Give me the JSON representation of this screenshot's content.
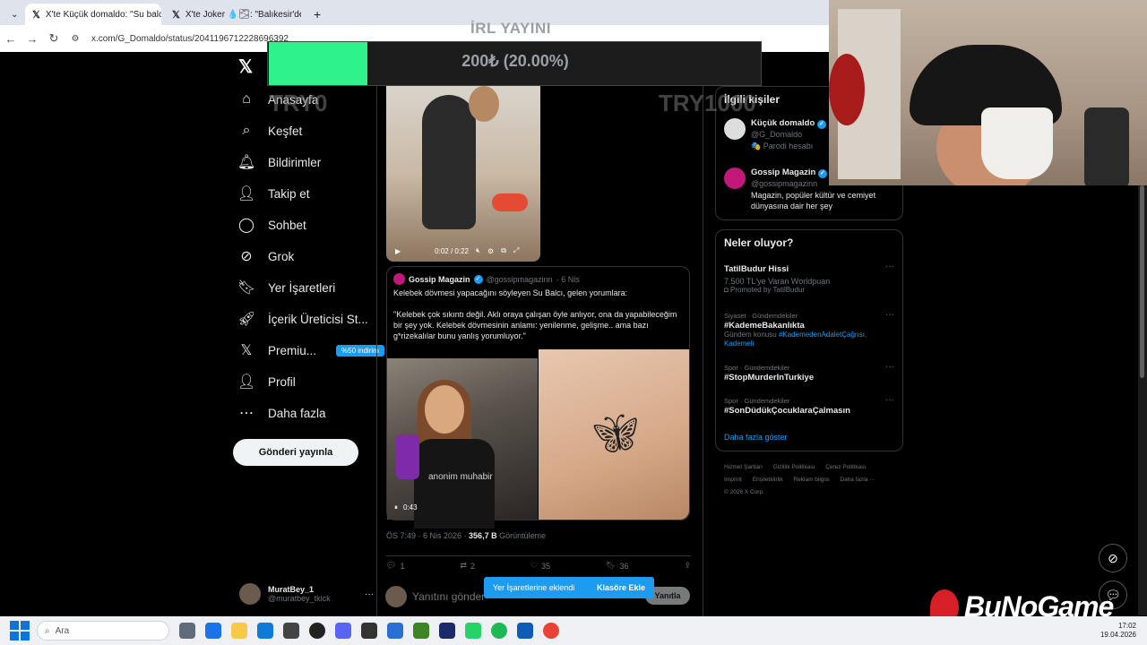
{
  "browser": {
    "tabs": [
      {
        "label": "X'te Küçük domaldo: \"Su balcı",
        "active": true
      },
      {
        "label": "X'te Joker 💧🌫: \"Balıkesir'de",
        "active": false
      }
    ],
    "new_tab": "+",
    "url": "x.com/G_Domaldo/status/2041196712228696392"
  },
  "overlay": {
    "title": "İRL YAYINI",
    "donation_text": "200₺ (20.00%)",
    "progress": 0.2,
    "min_label": "TRY0",
    "max_label": "TRY1000",
    "fill_color": "#2ef28b"
  },
  "nav": {
    "items": [
      {
        "label": "Anasayfa",
        "icon": "home-icon"
      },
      {
        "label": "Keşfet",
        "icon": "search-icon"
      },
      {
        "label": "Bildirimler",
        "icon": "bell-icon"
      },
      {
        "label": "Takip et",
        "icon": "add-person-icon"
      },
      {
        "label": "Sohbet",
        "icon": "chat-icon"
      },
      {
        "label": "Grok",
        "icon": "grok-icon"
      },
      {
        "label": "Yer İşaretleri",
        "icon": "bookmark-icon"
      },
      {
        "label": "İçerik Üreticisi St...",
        "icon": "rocket-icon"
      },
      {
        "label": "Premiu...",
        "icon": "x-icon",
        "badge": "%50 indirim"
      },
      {
        "label": "Profil",
        "icon": "person-icon"
      },
      {
        "label": "Daha fazla",
        "icon": "more-icon"
      }
    ],
    "post_button": "Gönderi yayınla",
    "user": {
      "name": "MuratBey_1",
      "handle": "@muratbey_tkick",
      "more": "···"
    }
  },
  "tweet": {
    "video_time": "0:02 / 0:22",
    "quote": {
      "name": "Gossip Magazin",
      "handle": "@gossipmagazinn",
      "date": "· 6 Nis",
      "text1": "Kelebek dövmesi yapacağını söyleyen Su Balcı, gelen yorumlara:",
      "text2": "\"Kelebek çok sıkıntı değil. Aklı oraya çalışan öyle anlıyor, ona da yapabileceğim bir şey yok. Kelebek dövmesinin anlamı: yenilenme, gelişme.. ama bazı g*rizekalılar bunu yanlış yorumluyor.\"",
      "watermark": "anonim muhabir",
      "video_time": "0:43"
    },
    "meta_time": "ÖS 7:49 · 6 Nis 2026 · ",
    "views": "356,7 B",
    "views_label": " Görüntüleme",
    "actions": {
      "replies": "1",
      "reposts": "2",
      "likes": "35",
      "bookmarks": "36"
    },
    "reply_placeholder": "Yanıtını gönder",
    "reply_button": "Yanıtla",
    "toast": {
      "text": "Yer İşaretlerine eklendi",
      "action": "Klasöre Ekle"
    }
  },
  "related": {
    "title": "İlgili kişiler",
    "users": [
      {
        "name": "Küçük domaldo",
        "handle": "@G_Domaldo",
        "note": "🎭 Parodi hesabı"
      },
      {
        "name": "Gossip Magazin",
        "handle": "@gossipmagazinn",
        "bio": "Magazin, popüler kültür ve cemiyet dünyasına dair her şey"
      }
    ]
  },
  "trends": {
    "title": "Neler oluyor?",
    "items": [
      {
        "meta": "",
        "name": "TatilBudur Hissi",
        "sub": "7.500 TL'ye Varan Worldpuan",
        "sub2": "◘ Promoted by TatilBudur"
      },
      {
        "meta": "Siyaset · Gündemdekiler",
        "name": "#KademeBakanlıkta",
        "sub": "Gündem konusu ",
        "link": "#KademedenAdaletÇağrısı",
        "sub2": "Kademeli"
      },
      {
        "meta": "Spor · Gündemdekiler",
        "name": "#StopMurderInTurkiye"
      },
      {
        "meta": "Spor · Gündemdekiler",
        "name": "#SonDüdükÇocuklaraÇalmasın"
      }
    ],
    "more": "Daha fazla göster",
    "footer": [
      "Hizmet Şartları",
      "Gizlilik Politikası",
      "Çerez Politikası",
      "Imprint",
      "Erişilebilirlik",
      "Reklam bilgisi",
      "Daha fazla ···",
      "© 2026 X Corp."
    ]
  },
  "branding": {
    "logo_text": "BuNoGame"
  },
  "taskbar": {
    "search_placeholder": "Ara",
    "time": "17:02",
    "date": "19.04.2026"
  }
}
